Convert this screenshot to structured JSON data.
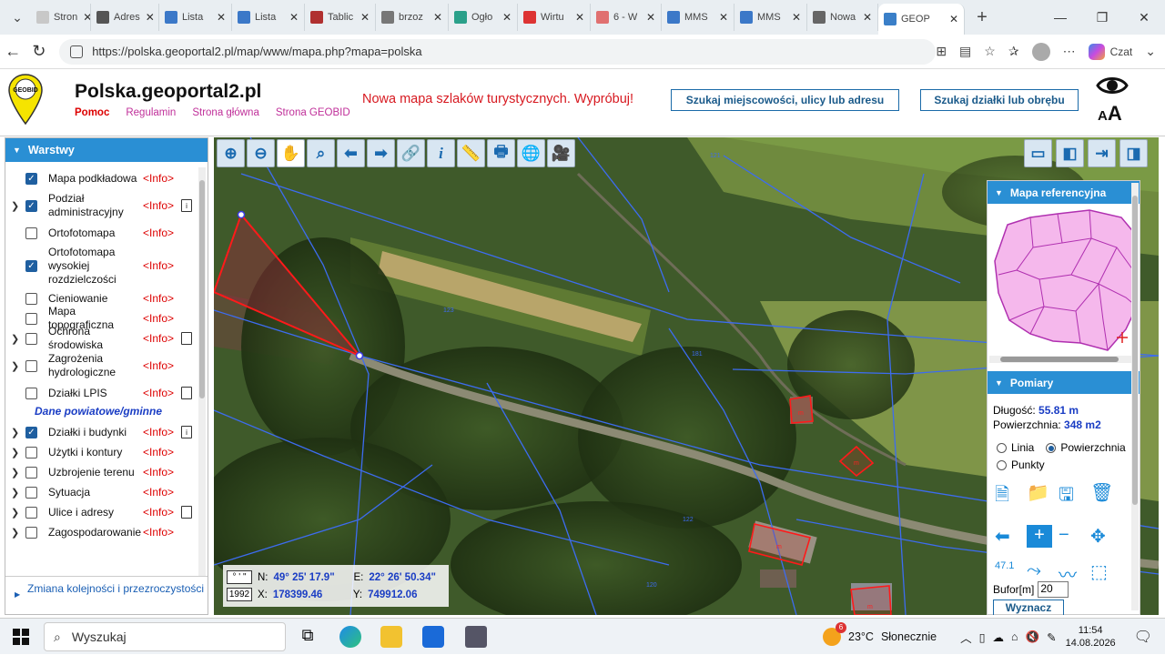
{
  "browser": {
    "tabs": [
      {
        "label": "Stron",
        "fav": "#c8c8c8"
      },
      {
        "label": "Adres",
        "fav": "#555"
      },
      {
        "label": "Lista",
        "fav": "#3b78c8"
      },
      {
        "label": "Lista",
        "fav": "#3b78c8"
      },
      {
        "label": "Tablic",
        "fav": "#b03030"
      },
      {
        "label": "brzoz",
        "fav": "#777"
      },
      {
        "label": "Ogło",
        "fav": "#2aa08a"
      },
      {
        "label": "Wirtu",
        "fav": "#d33"
      },
      {
        "label": "6 - W",
        "fav": "#e07070"
      },
      {
        "label": "MMS",
        "fav": "#3b78c8"
      },
      {
        "label": "MMS",
        "fav": "#3b78c8"
      },
      {
        "label": "Nowa",
        "fav": "#666"
      },
      {
        "label": "GEOP",
        "fav": "#3a7fc8",
        "active": true
      }
    ],
    "url": "https://polska.geoportal2.pl/map/www/mapa.php?mapa=polska",
    "copilot": "Czat"
  },
  "header": {
    "title": "Polska.geoportal2.pl",
    "logo_text": "GEOBID",
    "links": [
      "Pomoc",
      "Regulamin",
      "Strona główna",
      "Strona GEOBID"
    ],
    "promo": "Nowa mapa szlaków turystycznych. Wypróbuj!",
    "search_address": "Szukaj miejscowości, ulicy lub adresu",
    "search_parcel": "Szukaj działki lub obrębu",
    "font_size_label": "AA"
  },
  "sidebar": {
    "title": "Warstwy",
    "info": "<Info>",
    "layers": [
      {
        "name": "Mapa podkładowa",
        "checked": true,
        "arrow": false,
        "doc": ""
      },
      {
        "name": "Podział administracyjny",
        "checked": true,
        "arrow": true,
        "doc": "i"
      },
      {
        "name": "Ortofotomapa",
        "checked": false,
        "arrow": false,
        "doc": ""
      },
      {
        "name": "Ortofotomapa wysokiej rozdzielczości",
        "checked": true,
        "arrow": false,
        "doc": ""
      },
      {
        "name": "Cieniowanie",
        "checked": false,
        "arrow": false,
        "doc": ""
      },
      {
        "name": "Mapa topograficzna",
        "checked": false,
        "arrow": false,
        "doc": ""
      },
      {
        "name": "Ochrona środowiska",
        "checked": false,
        "arrow": true,
        "doc": "d"
      },
      {
        "name": "Zagrożenia hydrologiczne",
        "checked": false,
        "arrow": true,
        "doc": ""
      },
      {
        "name": "Działki LPIS",
        "checked": false,
        "arrow": false,
        "doc": "d"
      }
    ],
    "section": "Dane powiatowe/gminne",
    "layers2": [
      {
        "name": "Działki i budynki",
        "checked": true,
        "arrow": true,
        "doc": "i"
      },
      {
        "name": "Użytki i kontury",
        "checked": false,
        "arrow": true,
        "doc": ""
      },
      {
        "name": "Uzbrojenie terenu",
        "checked": false,
        "arrow": true,
        "doc": ""
      },
      {
        "name": "Sytuacja",
        "checked": false,
        "arrow": true,
        "doc": ""
      },
      {
        "name": "Ulice i adresy",
        "checked": false,
        "arrow": true,
        "doc": "d"
      },
      {
        "name": "Zagospodarowanie",
        "checked": false,
        "arrow": true,
        "doc": ""
      }
    ],
    "footer": "Zmiana kolejności i przezroczystości"
  },
  "map": {
    "parcel_labels": [
      "121",
      "123",
      "181",
      "122",
      "120"
    ],
    "building_labels": [
      "m",
      "m",
      "m",
      "m"
    ]
  },
  "refmap": {
    "title": "Mapa referencyjna"
  },
  "measure": {
    "title": "Pomiary",
    "length_label": "Długość:",
    "length_value": "55.81 m",
    "area_label": "Powierzchnia:",
    "area_value": "348 m2",
    "mode_line": "Linia",
    "mode_area": "Powierzchnia",
    "mode_points": "Punkty",
    "buffer_label": "Bufor[m]",
    "buffer_value": "20",
    "calc_button": "Wyznacz"
  },
  "coords": {
    "badge_dms": "° ' \"",
    "badge_1992": "1992",
    "n_label": "N:",
    "n_value": "49° 25' 17.9\"",
    "e_label": "E:",
    "e_value": "22° 26' 50.34\"",
    "x_label": "X:",
    "x_value": "178399.46",
    "y_label": "Y:",
    "y_value": "749912.06"
  },
  "taskbar": {
    "search": "Wyszukaj",
    "weather_temp": "23°C",
    "weather_text": "Słonecznie",
    "weather_badge": "6",
    "time": "11:54",
    "date": "14.08.2026"
  }
}
